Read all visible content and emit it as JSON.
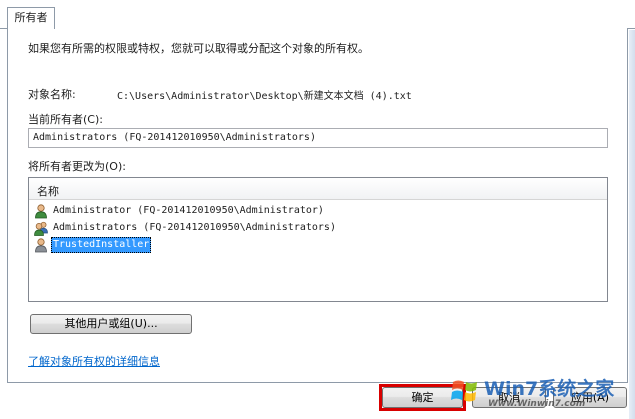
{
  "tabs": [
    {
      "label": "所有者"
    }
  ],
  "description": "如果您有所需的权限或特权，您就可以取得或分配这个对象的所有权。",
  "object": {
    "label": "对象名称:",
    "value": "C:\\Users\\Administrator\\Desktop\\新建文本文档 (4).txt"
  },
  "current_owner": {
    "label": "当前所有者(C):",
    "value": "Administrators (FQ-201412010950\\Administrators)"
  },
  "change_owner": {
    "label": "将所有者更改为(O):",
    "column_header": "名称",
    "items": [
      {
        "label": "Administrator (FQ-201412010950\\Administrator)",
        "icon": "single-user-icon",
        "selected": false
      },
      {
        "label": "Administrators (FQ-201412010950\\Administrators)",
        "icon": "user-group-icon",
        "selected": false
      },
      {
        "label": "TrustedInstaller",
        "icon": "single-user-icon",
        "selected": true
      }
    ]
  },
  "other_users_button": "其他用户或组(U)...",
  "help_link": "了解对象所有权的详细信息",
  "buttons": {
    "ok": "确定",
    "cancel": "取消",
    "apply": "应用(A)"
  },
  "watermark": {
    "main": "Win7系统之家",
    "url": "Www.Winwin7.com"
  },
  "colors": {
    "selection": "#3399ff",
    "link": "#0066cc",
    "highlight_frame": "#d80000"
  }
}
